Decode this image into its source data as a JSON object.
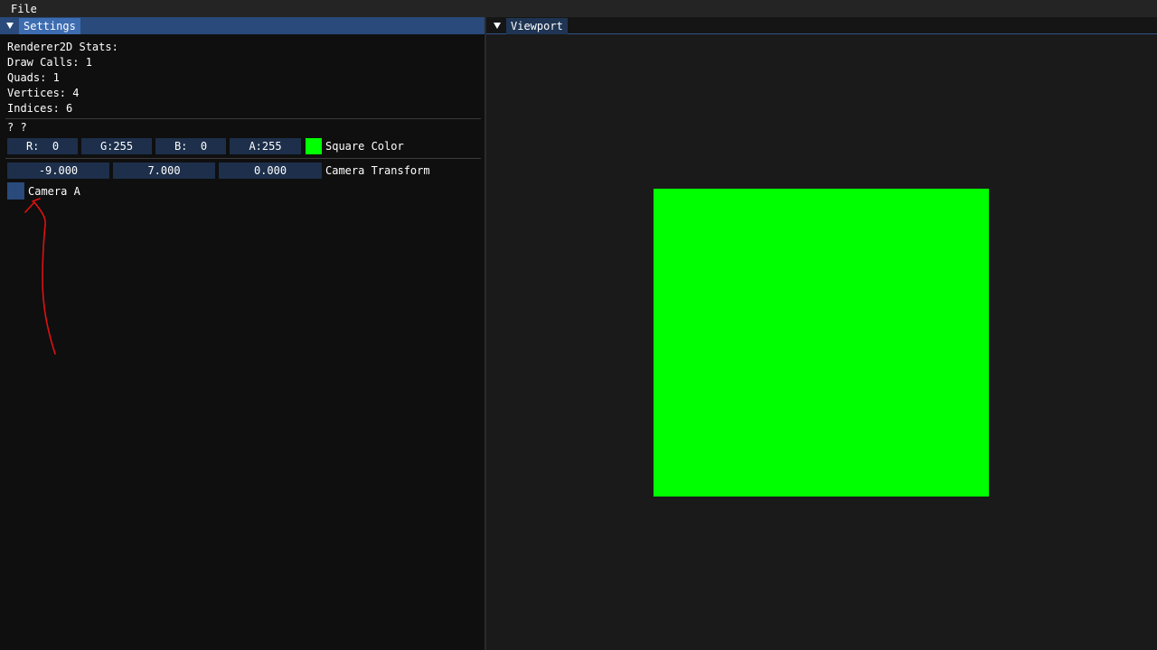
{
  "menubar": {
    "items": [
      {
        "label": "File"
      }
    ]
  },
  "settings": {
    "tab_label": "Settings",
    "stats": {
      "heading": "Renderer2D Stats:",
      "draw_calls": "Draw Calls: 1",
      "quads": "Quads: 1",
      "vertices": "Vertices: 4",
      "indices": "Indices: 6"
    },
    "unknown_label": "? ?",
    "square_color": {
      "r": "R:  0",
      "g": "G:255",
      "b": "B:  0",
      "a": "A:255",
      "swatch_color": "#00ff00",
      "label": "Square Color"
    },
    "camera_transform": {
      "x": "-9.000",
      "y": "7.000",
      "z": "0.000",
      "label": "Camera Transform"
    },
    "camera_checkbox": {
      "label": "Camera A",
      "checked": false
    }
  },
  "viewport": {
    "tab_label": "Viewport",
    "square_color": "#00ff00"
  },
  "colors": {
    "accent": "#294a7a",
    "tab_active": "#3d6cb0",
    "annotation": "#e01010"
  }
}
